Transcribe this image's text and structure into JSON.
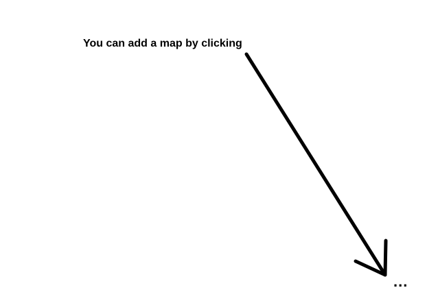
{
  "annotation": {
    "text": "You can add a map by clicking",
    "continuation": "...",
    "ink_color": "#000000",
    "background_color": "#ffffff",
    "arrow_icon": "arrow-down-right-icon"
  }
}
